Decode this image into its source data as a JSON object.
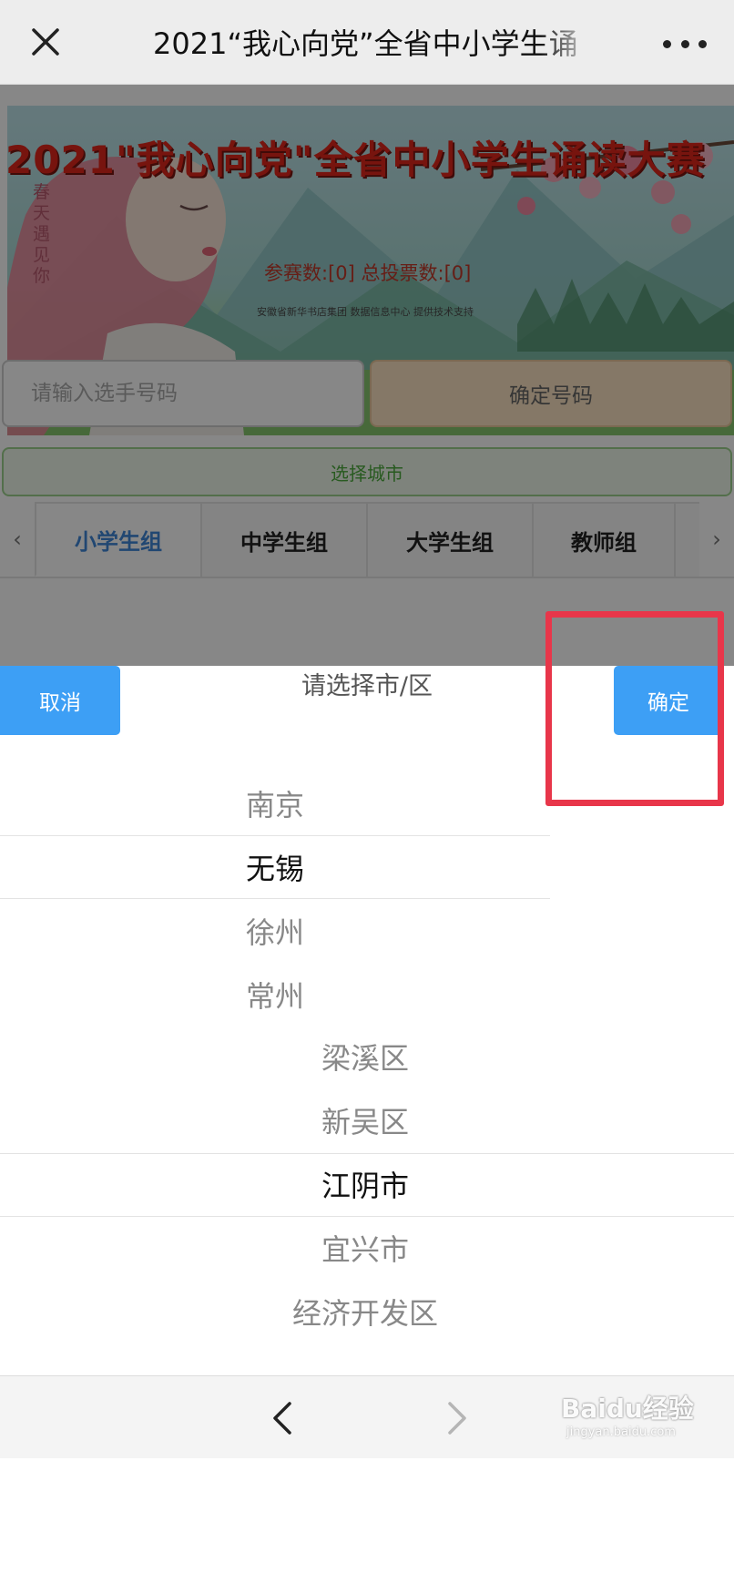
{
  "navbar": {
    "title": "2021“我心向党”全省中小学生诵"
  },
  "banner": {
    "title": "2021\"我心向党\"全省中小学生诵读大赛",
    "stats": "参赛数:[0] 总投票数:[0]",
    "credit": "安徽省新华书店集团 数据信息中心 提供技术支持",
    "poem": "春天遇见你"
  },
  "search": {
    "placeholder": "请输入选手号码",
    "confirm_label": "确定号码"
  },
  "city_button_label": "选择城市",
  "tabs": [
    {
      "label": "小学生组",
      "active": true
    },
    {
      "label": "中学生组",
      "active": false
    },
    {
      "label": "大学生组",
      "active": false
    },
    {
      "label": "教师组",
      "active": false
    }
  ],
  "picker": {
    "cancel_label": "取消",
    "title": "请选择市/区",
    "ok_label": "确定",
    "cities": [
      {
        "label": "南京",
        "selected": false
      },
      {
        "label": "无锡",
        "selected": true
      },
      {
        "label": "徐州",
        "selected": false
      },
      {
        "label": "常州",
        "selected": false
      }
    ],
    "districts": [
      {
        "label": "梁溪区",
        "selected": false
      },
      {
        "label": "新吴区",
        "selected": false
      },
      {
        "label": "江阴市",
        "selected": true
      },
      {
        "label": "宜兴市",
        "selected": false
      },
      {
        "label": "经济开发区",
        "selected": false
      }
    ]
  },
  "colors": {
    "accent": "#3d9ff5",
    "highlight": "#e8364a",
    "active_tab": "#3f86d8",
    "banner_title": "#e0261c"
  },
  "watermark": {
    "main": "Baidu经验",
    "sub": "jingyan.baidu.com"
  },
  "icons": {
    "close": "close-icon",
    "more": "more-icon",
    "back": "chevron-left-icon",
    "forward": "chevron-right-icon"
  }
}
